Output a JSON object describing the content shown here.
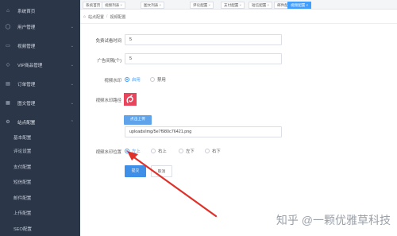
{
  "sidebar": {
    "items": [
      {
        "label": "系统首页",
        "icon": "home-icon",
        "chevron": ""
      },
      {
        "label": "用户管理",
        "icon": "user-icon",
        "chevron": "⌄"
      },
      {
        "label": "视频管理",
        "icon": "video-icon",
        "chevron": "⌄"
      },
      {
        "label": "VIP商品管理",
        "icon": "vip-icon",
        "chevron": "⌄"
      },
      {
        "label": "订单管理",
        "icon": "order-icon",
        "chevron": "⌄"
      },
      {
        "label": "图文管理",
        "icon": "article-icon",
        "chevron": "⌄"
      },
      {
        "label": "站点配置",
        "icon": "settings-icon",
        "chevron": "⌃"
      }
    ],
    "sub_items": [
      {
        "label": "基本配置"
      },
      {
        "label": "评论设置"
      },
      {
        "label": "支付配置"
      },
      {
        "label": "短信配置"
      },
      {
        "label": "邮件配置"
      },
      {
        "label": "上传配置"
      },
      {
        "label": "SEO配置"
      }
    ]
  },
  "tabs": [
    {
      "label": "系统首页",
      "close": "×"
    },
    {
      "label": "视频列表",
      "close": "×"
    },
    {
      "label": "图文列表",
      "close": "×"
    },
    {
      "label": "评论配置",
      "close": "×"
    },
    {
      "label": "支付配置",
      "close": "×"
    },
    {
      "label": "短信配置",
      "close": "×"
    },
    {
      "label": "邮件配置",
      "close": "×"
    },
    {
      "label": "视频配置",
      "close": "×"
    }
  ],
  "breadcrumb": {
    "first": "站点配置",
    "separator": "/",
    "second": "视频配置"
  },
  "form": {
    "trial_time": {
      "label": "免费试看时间",
      "value": "5"
    },
    "ad_interval": {
      "label": "广告间隔(个)",
      "value": "5"
    },
    "watermark": {
      "label": "视频水印",
      "options": [
        "启用",
        "禁用"
      ],
      "selected": "启用"
    },
    "watermark_path": {
      "label": "视频水印路径",
      "upload_label": "点击上传",
      "value": "uploads/img/5e7f980c76421.png"
    },
    "watermark_position": {
      "label": "视频水印位置",
      "options": [
        "左上",
        "右上",
        "左下",
        "右下"
      ],
      "selected": "左上"
    },
    "submit_label": "提交",
    "cancel_label": "取消"
  },
  "watermark_brand": "知乎 @一颗优雅草科技",
  "colors": {
    "sidebar_bg": "#2b3648",
    "accent": "#409eff",
    "arrow": "#e0302a"
  }
}
